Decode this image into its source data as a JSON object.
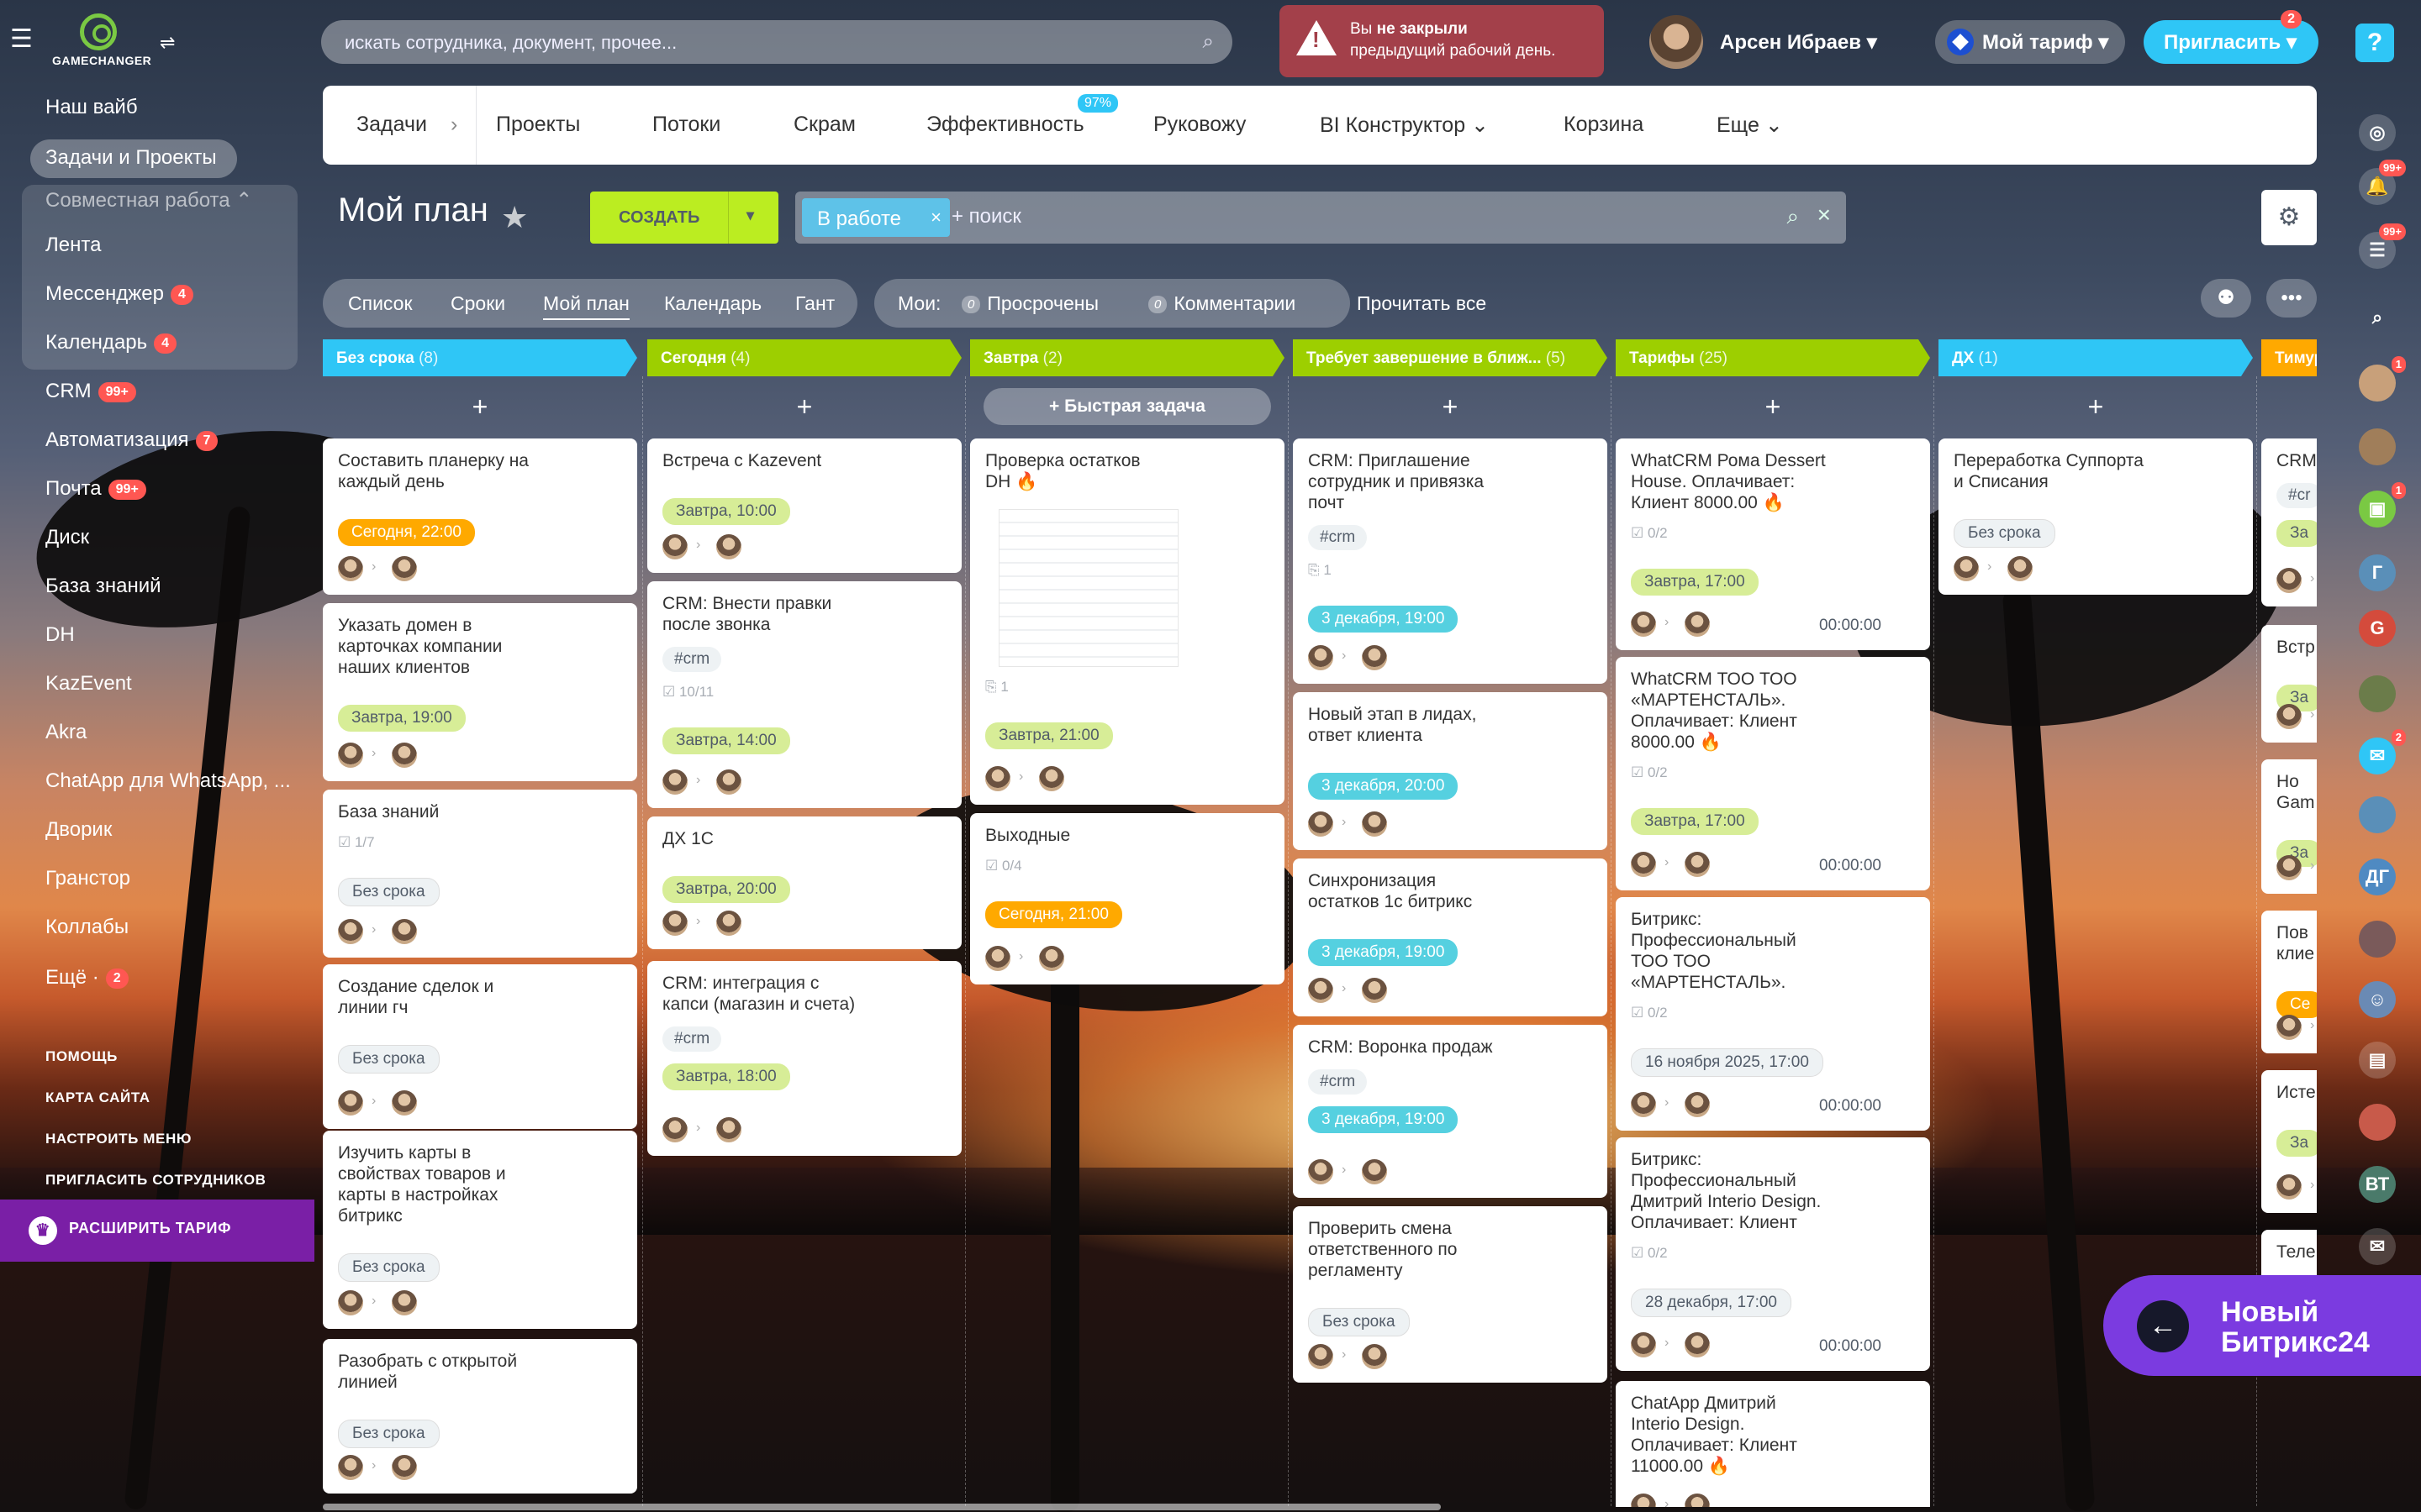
{
  "app": {
    "logo_text": "GAMECHANGER",
    "search_placeholder": "искать сотрудника, документ, прочее...",
    "alert": {
      "line1_prefix": "Вы ",
      "line1_bold": "не закрыли",
      "line2": "предыдущий рабочий день."
    },
    "user_name": "Арсен Ибраев",
    "tariff_label": "Мой тариф",
    "invite_label": "Пригласить",
    "invite_badge": "2",
    "help_label": "?"
  },
  "sidebar": {
    "items": [
      {
        "label": "Наш вайб"
      },
      {
        "label": "Задачи и Проекты"
      },
      {
        "label": "Совместная работа ⌃"
      },
      {
        "label": "Лента"
      },
      {
        "label": "Мессенджер",
        "count": "4"
      },
      {
        "label": "Календарь",
        "count": "4"
      },
      {
        "label": "CRM",
        "count": "99+"
      },
      {
        "label": "Автоматизация",
        "count": "7"
      },
      {
        "label": "Почта",
        "count": "99+"
      },
      {
        "label": "Диск"
      },
      {
        "label": "База знаний"
      },
      {
        "label": "DH"
      },
      {
        "label": "KazEvent"
      },
      {
        "label": "Akra"
      },
      {
        "label": "ChatApp для WhatsApp, ..."
      },
      {
        "label": "Дворик"
      },
      {
        "label": "Гранстор"
      },
      {
        "label": "Коллабы"
      },
      {
        "label": "Ещё ·",
        "count": "2"
      }
    ],
    "footer": [
      "ПОМОЩЬ",
      "КАРТА САЙТА",
      "НАСТРОИТЬ МЕНЮ",
      "ПРИГЛАСИТЬ СОТРУДНИКОВ"
    ],
    "upgrade_label": "РАСШИРИТЬ ТАРИФ"
  },
  "topnav": {
    "items": [
      "Задачи",
      "Проекты",
      "Потоки",
      "Скрам",
      "Эффективность",
      "Руковожу",
      "BI Конструктор ⌄",
      "Корзина",
      "Еще ⌄"
    ],
    "efficiency_badge": "97%"
  },
  "toolbar": {
    "title": "Мой план",
    "create_label": "СОЗДАТЬ",
    "filter_chip": "В работе",
    "filter_placeholder": "+ поиск"
  },
  "views": {
    "tabs": [
      "Список",
      "Сроки",
      "Мой план",
      "Календарь",
      "Гант"
    ],
    "active": "Мой план",
    "moi_label": "Мои:",
    "overdue_count": "0",
    "overdue_label": "Просрочены",
    "comments_count": "0",
    "comments_label": "Комментарии",
    "read_all": "Прочитать все"
  },
  "colors": {
    "accent": "#2fc6f6",
    "create": "#bbed21",
    "badge": "#ff5752"
  },
  "columns": [
    {
      "name": "Без срока",
      "count": "(8)",
      "color": "#2fc6f6",
      "cards": [
        {
          "title": "Составить планерку на\nкаждый день",
          "due": "Сегодня, 22:00",
          "due_style": "orange"
        },
        {
          "title": "Указать домен в\nкарточках компании\nнаших клиентов",
          "due": "Завтра, 19:00",
          "due_style": "lime"
        },
        {
          "title": "База знаний",
          "checklist": "1/7",
          "due": "Без срока",
          "due_style": "gray"
        },
        {
          "title": "Создание сделок и\nлинии гч",
          "due": "Без срока",
          "due_style": "gray"
        },
        {
          "title": "Изучить карты в\nсвойствах товаров и\nкарты в настройках\nбитрикс",
          "due": "Без срока",
          "due_style": "gray"
        },
        {
          "title": "Разобрать с открытой\nлинией",
          "due": "Без срока",
          "due_style": "gray"
        }
      ]
    },
    {
      "name": "Сегодня",
      "count": "(4)",
      "color": "#9dcf00",
      "cards": [
        {
          "title": "Встреча с Kazevent",
          "due": "Завтра, 10:00",
          "due_style": "lime"
        },
        {
          "title": "CRM: Внести правки\nпосле звонка",
          "tag": "#crm",
          "checklist": "10/11",
          "due": "Завтра, 14:00",
          "due_style": "lime"
        },
        {
          "title": "ДХ 1С",
          "due": "Завтра, 20:00",
          "due_style": "lime"
        },
        {
          "title": "CRM: интеграция с\nкапси (магазин и счета)",
          "tag": "#crm",
          "due": "Завтра, 18:00",
          "due_style": "lime"
        }
      ]
    },
    {
      "name": "Завтра",
      "count": "(2)",
      "color": "#9dcf00",
      "quick": "+ Быстрая задача",
      "cards": [
        {
          "title": "Проверка остатков\nDH",
          "fire": true,
          "thumb": true,
          "clip": "1",
          "due": "Завтра, 21:00",
          "due_style": "lime"
        },
        {
          "title": "Выходные",
          "checklist": "0/4",
          "due": "Сегодня, 21:00",
          "due_style": "orange"
        }
      ]
    },
    {
      "name": "Требует завершение в ближ...",
      "count": "(5)",
      "color": "#9dcf00",
      "cards": [
        {
          "title": "CRM: Приглашение\nсотрудник и привязка\nпочт",
          "tag": "#crm",
          "clip": "1",
          "due": "3 декабря, 19:00",
          "due_style": "blue"
        },
        {
          "title": "Новый этап в лидах,\nответ клиента",
          "due": "3 декабря, 20:00",
          "due_style": "blue"
        },
        {
          "title": "Синхронизация\nостатков 1с битрикс",
          "due": "3 декабря, 19:00",
          "due_style": "blue"
        },
        {
          "title": "CRM: Воронка продаж",
          "tag": "#crm",
          "due": "3 декабря, 19:00",
          "due_style": "blue"
        },
        {
          "title": "Проверить смена\nответственного по\nрегламенту",
          "due": "Без срока",
          "due_style": "gray"
        }
      ]
    },
    {
      "name": "Тарифы",
      "count": "(25)",
      "color": "#9dcf00",
      "cards": [
        {
          "title": "WhatCRM Рома Dessert\nHouse. Оплачивает:\nКлиент 8000.00",
          "fire": true,
          "checklist": "0/2",
          "due": "Завтра, 17:00",
          "due_style": "lime",
          "timer": "00:00:00"
        },
        {
          "title": "WhatCRM ТОО ТОО\n«МАРТЕНСТАЛЬ».\nОплачивает: Клиент\n8000.00",
          "fire": true,
          "checklist": "0/2",
          "due": "Завтра, 17:00",
          "due_style": "lime",
          "timer": "00:00:00"
        },
        {
          "title": "Битрикс:\nПрофессиональный\nТОО ТОО\n«МАРТЕНСТАЛЬ».",
          "checklist": "0/2",
          "due": "16 ноября 2025, 17:00",
          "due_style": "gray",
          "timer": "00:00:00"
        },
        {
          "title": "Битрикс:\nПрофессиональный\nДмитрий Interio Design.\nОплачивает: Клиент",
          "checklist": "0/2",
          "due": "28 декабря, 17:00",
          "due_style": "gray",
          "timer": "00:00:00"
        },
        {
          "title": "ChatApp Дмитрий\nInterio Design.\nОплачивает: Клиент\n11000.00",
          "fire": true
        }
      ]
    },
    {
      "name": "ДХ",
      "count": "(1)",
      "color": "#2fc6f6",
      "cards": [
        {
          "title": "Переработка Суппорта\nи Списания",
          "due": "Без срока",
          "due_style": "gray"
        }
      ]
    },
    {
      "name": "Тимур",
      "count": "",
      "color": "#ffa900",
      "cards": [
        {
          "title": "CRM",
          "tag": "#cr",
          "due": "За",
          "due_style": "lime"
        },
        {
          "title": "Встр",
          "due": "За",
          "due_style": "lime"
        },
        {
          "title": "Но\nGam",
          "due": "За",
          "due_style": "lime"
        },
        {
          "title": "Пов\nклие",
          "due": "Се",
          "due_style": "orange"
        },
        {
          "title": "Исте",
          "due": "За",
          "due_style": "lime"
        },
        {
          "title": "Теле"
        }
      ]
    }
  ],
  "rail": {
    "badges": [
      "99+",
      "99+",
      "1",
      "2",
      "1"
    ],
    "letters": [
      "Г",
      "G",
      "ДГ",
      "ВТ"
    ]
  },
  "new_bitrix": {
    "line1": "Новый",
    "line2": "Битрикс24"
  }
}
